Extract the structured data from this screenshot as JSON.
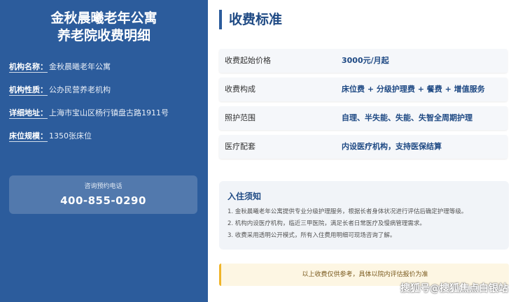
{
  "left": {
    "title_line1": "金秋晨曦老年公寓",
    "title_line2": "养老院收费明细",
    "info": [
      {
        "label": "机构名称：",
        "value": "金秋晨曦老年公寓"
      },
      {
        "label": "机构性质：",
        "value": "公办民营养老机构"
      },
      {
        "label": "详细地址：",
        "value": "上海市宝山区杨行镇盘古路1911号"
      },
      {
        "label": "床位规模：",
        "value": "1350张床位"
      }
    ],
    "contact": {
      "label": "咨询预约电话",
      "phone": "400-855-0290"
    }
  },
  "right": {
    "heading": "收费标准",
    "fees": [
      {
        "key": "收费起始价格",
        "value": "3000元/月起"
      },
      {
        "key": "收费构成",
        "value": "床位费 + 分级护理费 + 餐费 + 增值服务"
      },
      {
        "key": "照护范围",
        "value": "自理、半失能、失能、失智全周期护理"
      },
      {
        "key": "医疗配套",
        "value": "内设医疗机构，支持医保结算"
      }
    ],
    "notice": {
      "title": "入住须知",
      "items": [
        "1. 金秋晨曦老年公寓提供专业分级护理服务，根据长者身体状况进行评估后确定护理等级。",
        "2. 机构内设医疗机构，临近三甲医院，满足长者日常医疗及慢病管理需求。",
        "3. 收费采用透明公开模式，所有入住费用明细可现场咨询了解。"
      ]
    },
    "disclaimer": "以上收费仅供参考，具体以院内评估报价为准"
  },
  "watermark": "搜狐号@搜狐焦点白银站",
  "colors": {
    "primary": "#2c5c9c",
    "accent": "#f0b429"
  }
}
